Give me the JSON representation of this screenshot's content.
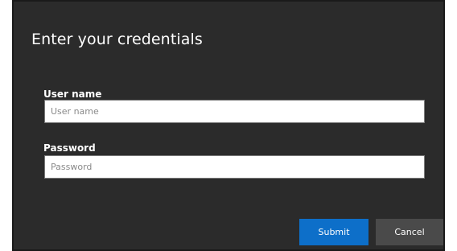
{
  "dialog": {
    "title": "Enter your credentials"
  },
  "username": {
    "label": "User name",
    "placeholder": "User name",
    "value": ""
  },
  "password": {
    "label": "Password",
    "placeholder": "Password",
    "value": ""
  },
  "buttons": {
    "submit_label": "Submit",
    "cancel_label": "Cancel"
  },
  "colors": {
    "dialog_background": "#2b2b2b",
    "submit_accent": "#0d6fc9",
    "cancel_background": "#4a4a4a"
  }
}
